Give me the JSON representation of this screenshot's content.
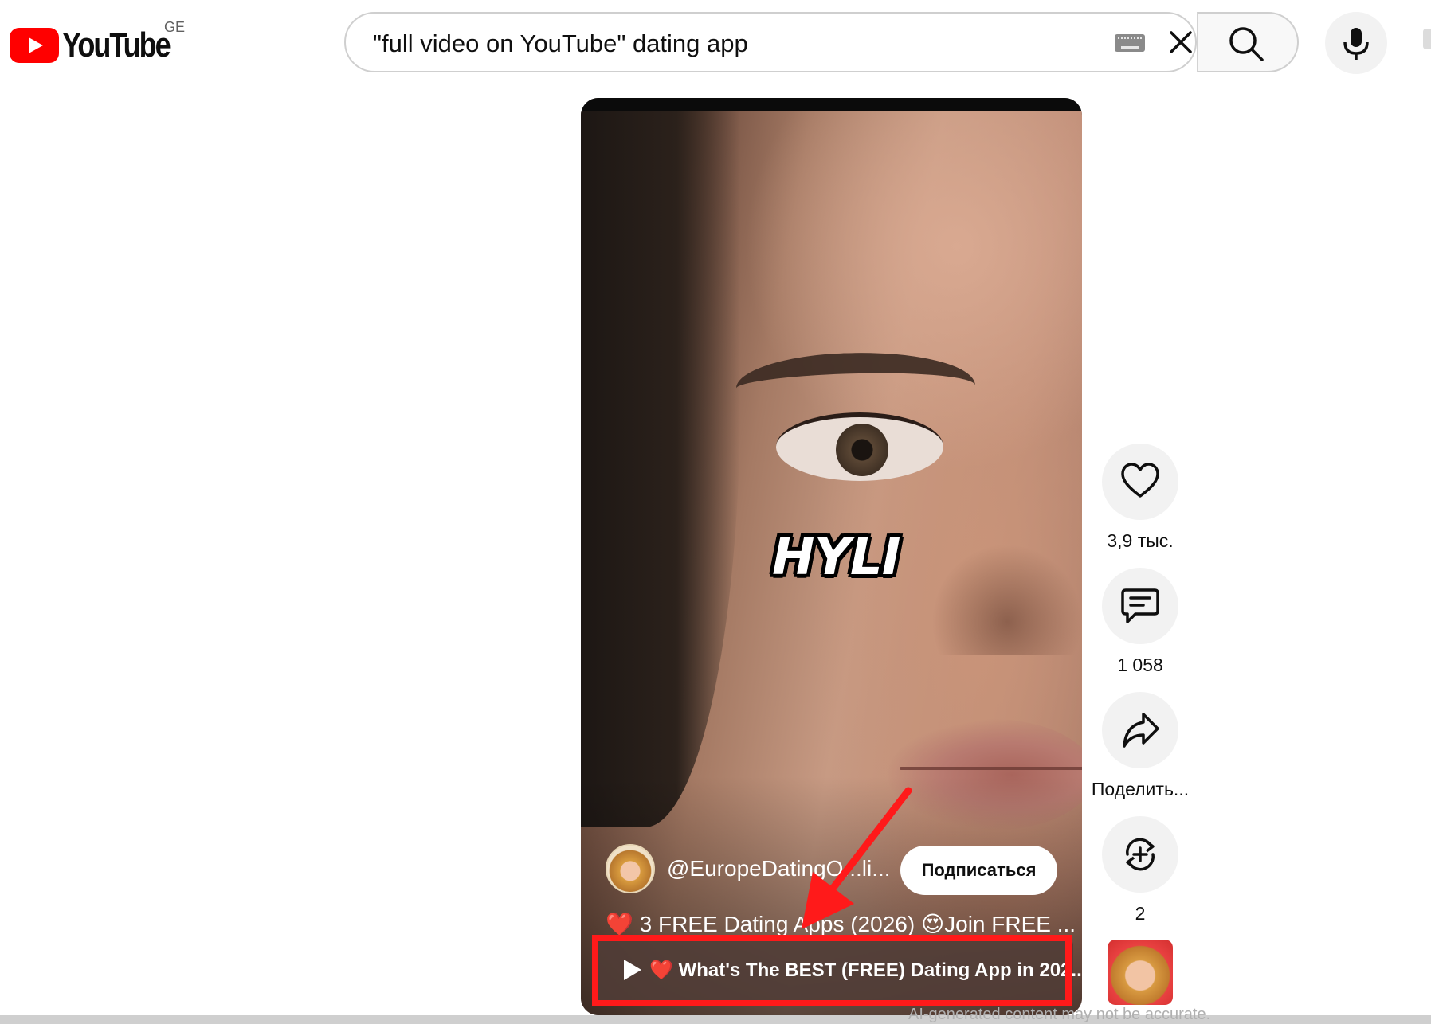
{
  "header": {
    "logo_text": "YouTube",
    "region": "GE",
    "search": {
      "value": "\"full video on YouTube\" dating app"
    }
  },
  "video": {
    "caption": "HYLI",
    "channel_handle": "@EuropeDatingO...li...",
    "subscribe_label": "Подписаться",
    "title": "❤️ 3 FREE Dating Apps (2026) 😍Join FREE ...",
    "related_link": "❤️ What's The BEST (FREE) Dating App in 202..."
  },
  "actions": {
    "like_count": "3,9 тыс.",
    "comment_count": "1 058",
    "share_label": "Поделить...",
    "remix_count": "2"
  },
  "footer": {
    "note": "AI-generated content may not be accurate."
  },
  "colors": {
    "brand_red": "#ff0000",
    "highlight": "#ff1a1a"
  }
}
